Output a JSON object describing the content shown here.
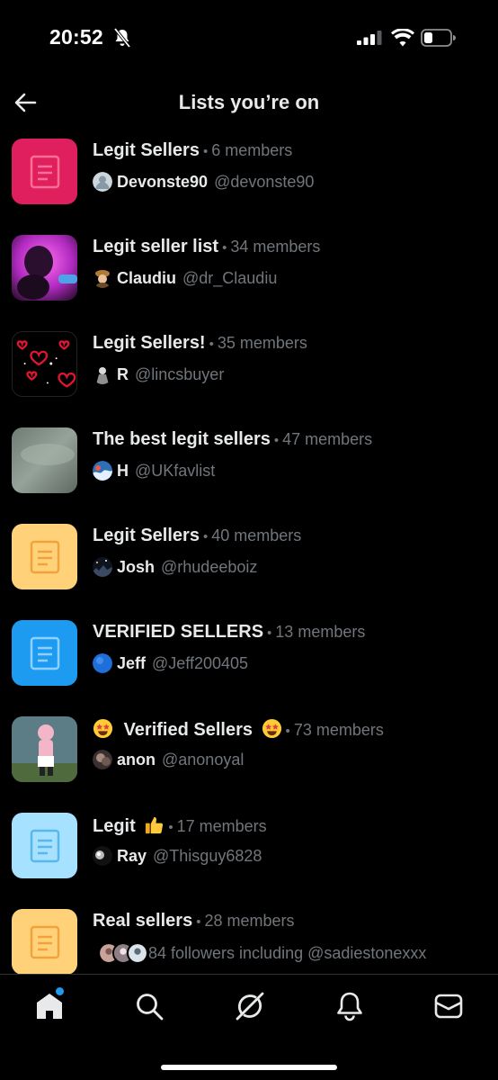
{
  "status_bar": {
    "time": "20:52"
  },
  "header": {
    "title": "Lists you’re on"
  },
  "lists": [
    {
      "name": "Legit Sellers",
      "members": "6 members",
      "owner_name": "Devonste90",
      "owner_handle": "@devonste90",
      "thumb_color": "#e01f5e",
      "icon_color": "#ff6f95"
    },
    {
      "name": "Legit seller list",
      "members": "34 members",
      "owner_name": "Claudiu",
      "owner_handle": "@dr_Claudiu",
      "thumb_color": "#b02ac0"
    },
    {
      "name": "Legit Sellers!",
      "members": "35 members",
      "owner_name": "R",
      "owner_handle": "@lincsbuyer",
      "thumb_color": "#000000"
    },
    {
      "name": "The best legit sellers",
      "members": "47 members",
      "owner_name": "H",
      "owner_handle": "@UKfavlist",
      "thumb_color": "#7a857c"
    },
    {
      "name": "Legit Sellers",
      "members": "40 members",
      "owner_name": "Josh",
      "owner_handle": "@rhudeeboiz",
      "thumb_color": "#ffd27a",
      "icon_color": "#f2a23a"
    },
    {
      "name": "VERIFIED SELLERS",
      "members": "13 members",
      "owner_name": "Jeff",
      "owner_handle": "@Jeff200405",
      "thumb_color": "#1d9bf0",
      "icon_color": "#8fd0ff"
    },
    {
      "name": "Verified Sellers",
      "members": "73 members",
      "owner_name": "anon",
      "owner_handle": "@anonoyal",
      "thumb_color": "#5d7d86"
    },
    {
      "name": "Legit",
      "members": "17 members",
      "owner_name": "Ray",
      "owner_handle": "@Thisguy6828",
      "thumb_color": "#a6e1ff",
      "icon_color": "#58b8ec"
    },
    {
      "name": "Real sellers",
      "members": "28 members",
      "followers_text": "84 followers including @sadiestonexxx",
      "thumb_color": "#ffd27a",
      "icon_color": "#f2a23a"
    }
  ],
  "bottom_nav": {
    "items": [
      "home-icon",
      "search-icon",
      "grok-icon",
      "notifications-icon",
      "messages-icon"
    ],
    "active_dot_color": "#1d9bf0"
  }
}
